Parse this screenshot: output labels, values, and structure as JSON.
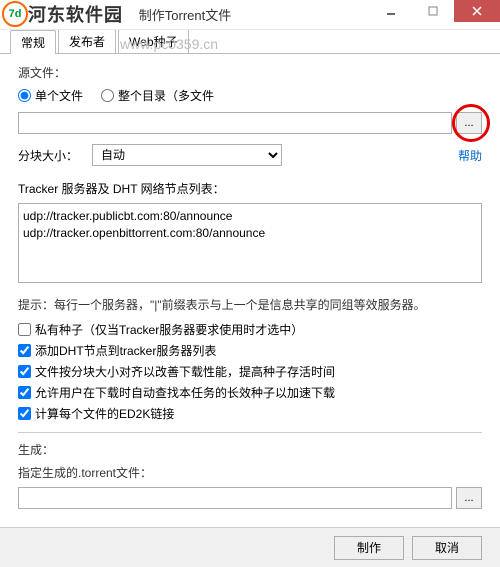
{
  "window": {
    "title": "制作Torrent文件",
    "overlay_brand": "河东软件园",
    "overlay_url": "www.pc0359.cn",
    "logo_inner": "7d"
  },
  "tabs": {
    "general": "常规",
    "publisher": "发布者",
    "webseed": "Web种子"
  },
  "source": {
    "label": "源文件：",
    "single": "单个文件",
    "folder": "整个目录（多文件",
    "path": "",
    "browse": "..."
  },
  "piece": {
    "label": "分块大小：",
    "value": "自动",
    "help": "帮助"
  },
  "tracker": {
    "label": "Tracker 服务器及 DHT 网络节点列表：",
    "value": "udp://tracker.publicbt.com:80/announce\nudp://tracker.openbittorrent.com:80/announce",
    "hint": "提示：每行一个服务器，\"|\"前缀表示与上一个是信息共享的同组等效服务器。"
  },
  "opts": {
    "private": "私有种子（仅当Tracker服务器要求使用时才选中）",
    "dht": "添加DHT节点到tracker服务器列表",
    "align": "文件按分块大小对齐以改善下载性能，提高种子存活时间",
    "longterm": "允许用户在下载时自动查找本任务的长效种子以加速下载",
    "ed2k": "计算每个文件的ED2K链接"
  },
  "gen": {
    "label": "生成：",
    "target_label": "指定生成的.torrent文件：",
    "target": "",
    "browse": "..."
  },
  "buttons": {
    "make": "制作",
    "cancel": "取消"
  }
}
